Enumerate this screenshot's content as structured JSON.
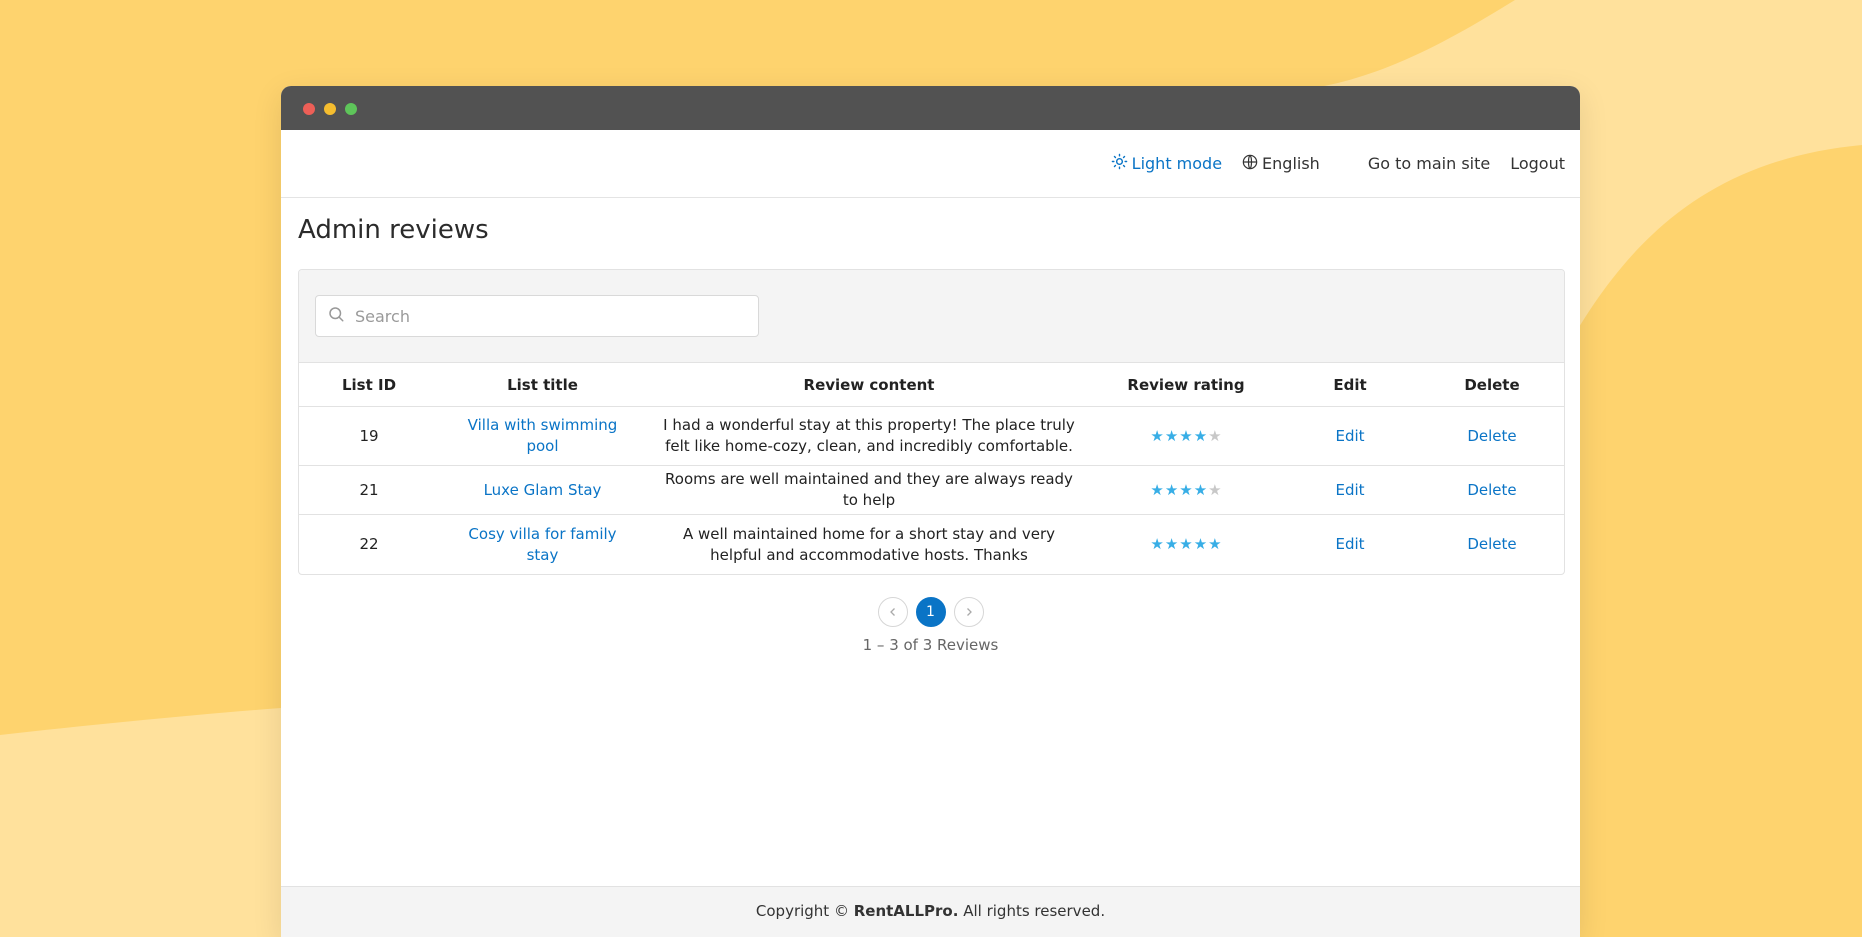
{
  "header": {
    "light_mode_label": "Light mode",
    "language_label": "English",
    "main_site_label": "Go to main site",
    "logout_label": "Logout"
  },
  "page": {
    "title": "Admin reviews"
  },
  "search": {
    "placeholder": "Search"
  },
  "table": {
    "columns": [
      "List ID",
      "List title",
      "Review content",
      "Review rating",
      "Edit",
      "Delete"
    ],
    "rows": [
      {
        "id": "19",
        "title": "Villa with swimming pool",
        "content": "I had a wonderful stay at this property! The place truly felt like home-cozy, clean, and incredibly comfortable.",
        "rating": 4,
        "edit": "Edit",
        "delete": "Delete"
      },
      {
        "id": "21",
        "title": "Luxe Glam Stay",
        "content": "Rooms are well maintained and they are always ready to help",
        "rating": 4,
        "edit": "Edit",
        "delete": "Delete"
      },
      {
        "id": "22",
        "title": "Cosy villa for family stay",
        "content": "A well maintained home for a short stay and very helpful and accommodative hosts. Thanks",
        "rating": 5,
        "edit": "Edit",
        "delete": "Delete"
      }
    ]
  },
  "pagination": {
    "current_page": "1",
    "summary": "1 – 3 of 3 Reviews"
  },
  "footer": {
    "prefix": "Copyright ©",
    "brand": "RentALLPro.",
    "suffix": "All rights reserved."
  },
  "colors": {
    "accent": "#0a74c6",
    "star": "#38aee6",
    "background": "#fed36e"
  }
}
